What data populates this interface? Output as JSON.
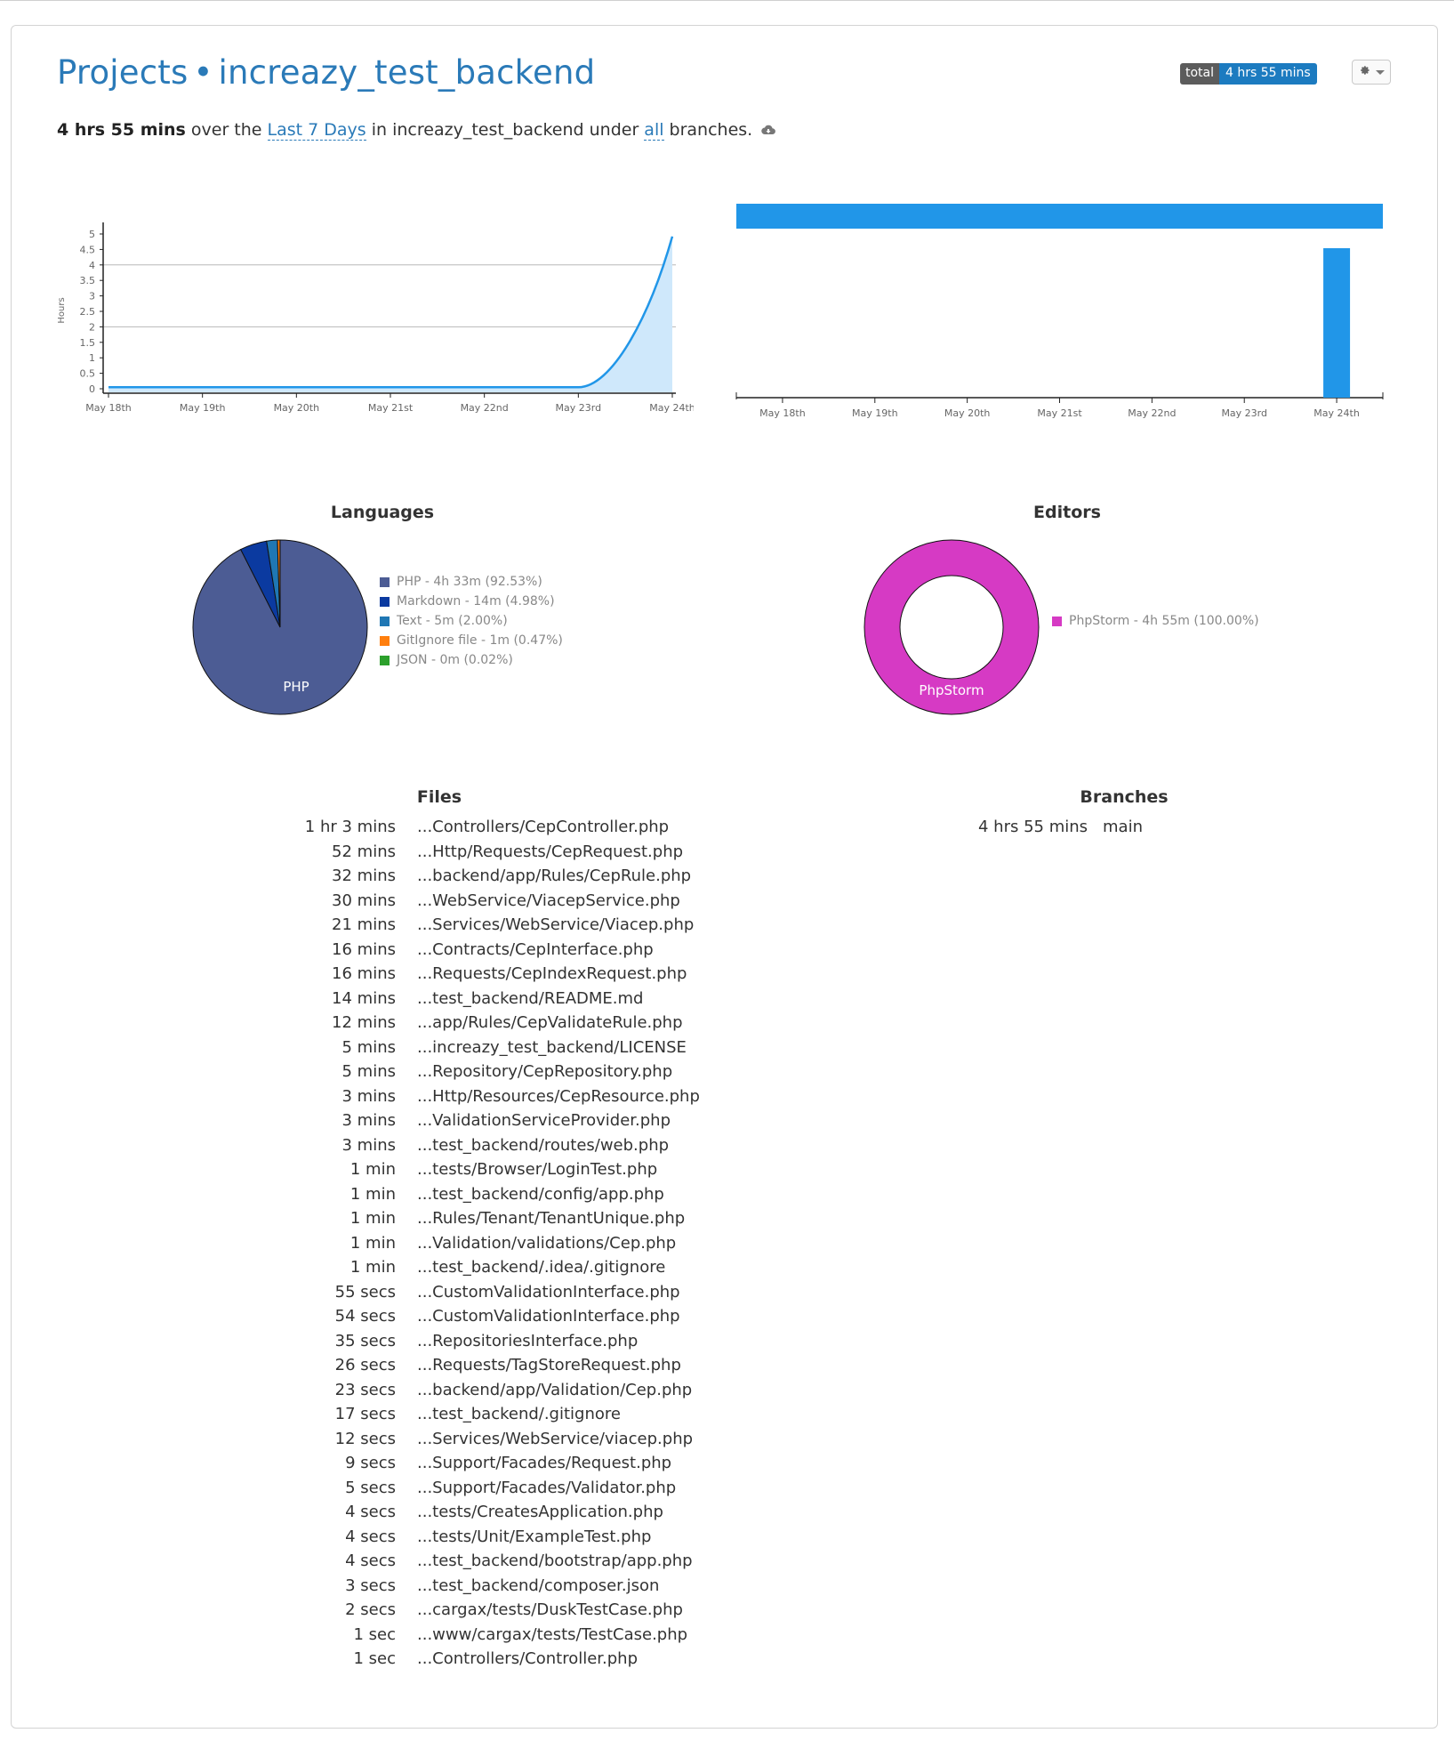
{
  "header": {
    "projects_label": "Projects",
    "separator": "•",
    "project_name": "increazy_test_backend",
    "badge_label": "total",
    "badge_value": "4 hrs 55 mins"
  },
  "summary": {
    "total": "4 hrs 55 mins",
    "text1": " over the ",
    "range_link": "Last 7 Days",
    "text2": " in increazy_test_backend under ",
    "branches_link": "all",
    "text3": " branches."
  },
  "icons": {
    "settings": "gear-icon",
    "cloud": "cloud-download-icon"
  },
  "colors": {
    "accent": "#2a7ab8",
    "line": "#2196e8",
    "area": "#cfe8fb",
    "bar": "#2196e8"
  },
  "chart_data": [
    {
      "type": "area",
      "ylabel": "Hours",
      "x": [
        "May 18th",
        "May 19th",
        "May 20th",
        "May 21st",
        "May 22nd",
        "May 23rd",
        "May 24th"
      ],
      "values": [
        0.05,
        0.05,
        0.05,
        0.05,
        0.05,
        0.05,
        4.92
      ],
      "yticks": [
        "0",
        "0.5",
        "1",
        "1.5",
        "2",
        "2.5",
        "3",
        "3.5",
        "4",
        "4.5",
        "5"
      ],
      "ylim": [
        0,
        5
      ],
      "grid_lines": [
        2,
        4
      ]
    },
    {
      "type": "bar",
      "x": [
        "May 18th",
        "May 19th",
        "May 20th",
        "May 21st",
        "May 22nd",
        "May 23rd",
        "May 24th"
      ],
      "values": [
        0,
        0,
        0,
        0,
        0,
        0,
        4.92
      ],
      "summary_bar": "total"
    },
    {
      "type": "pie",
      "title": "Languages",
      "slices": [
        {
          "label": "PHP - 4h 33m (92.53%)",
          "name": "PHP",
          "value": 92.53,
          "color": "#4c5c94"
        },
        {
          "label": "Markdown - 14m (4.98%)",
          "name": "Markdown",
          "value": 4.98,
          "color": "#0b3aa0"
        },
        {
          "label": "Text - 5m (2.00%)",
          "name": "Text",
          "value": 2.0,
          "color": "#1f77b4"
        },
        {
          "label": "GitIgnore file - 1m (0.47%)",
          "name": "GitIgnore file",
          "value": 0.47,
          "color": "#ff7f0e"
        },
        {
          "label": "JSON - 0m (0.02%)",
          "name": "JSON",
          "value": 0.02,
          "color": "#2ca02c"
        }
      ],
      "inner_label": "PHP"
    },
    {
      "type": "pie",
      "title": "Editors",
      "slices": [
        {
          "label": "PhpStorm - 4h 55m (100.00%)",
          "name": "PhpStorm",
          "value": 100.0,
          "color": "#d63ac4"
        }
      ],
      "inner_label": "PhpStorm"
    }
  ],
  "files": {
    "title": "Files",
    "rows": [
      {
        "time": "1 hr 3 mins",
        "name": "...Controllers/CepController.php"
      },
      {
        "time": "52 mins",
        "name": "...Http/Requests/CepRequest.php"
      },
      {
        "time": "32 mins",
        "name": "...backend/app/Rules/CepRule.php"
      },
      {
        "time": "30 mins",
        "name": "...WebService/ViacepService.php"
      },
      {
        "time": "21 mins",
        "name": "...Services/WebService/Viacep.php"
      },
      {
        "time": "16 mins",
        "name": "...Contracts/CepInterface.php"
      },
      {
        "time": "16 mins",
        "name": "...Requests/CepIndexRequest.php"
      },
      {
        "time": "14 mins",
        "name": "...test_backend/README.md"
      },
      {
        "time": "12 mins",
        "name": "...app/Rules/CepValidateRule.php"
      },
      {
        "time": "5 mins",
        "name": "...increazy_test_backend/LICENSE"
      },
      {
        "time": "5 mins",
        "name": "...Repository/CepRepository.php"
      },
      {
        "time": "3 mins",
        "name": "...Http/Resources/CepResource.php"
      },
      {
        "time": "3 mins",
        "name": "...ValidationServiceProvider.php"
      },
      {
        "time": "3 mins",
        "name": "...test_backend/routes/web.php"
      },
      {
        "time": "1 min",
        "name": "...tests/Browser/LoginTest.php"
      },
      {
        "time": "1 min",
        "name": "...test_backend/config/app.php"
      },
      {
        "time": "1 min",
        "name": "...Rules/Tenant/TenantUnique.php"
      },
      {
        "time": "1 min",
        "name": "...Validation/validations/Cep.php"
      },
      {
        "time": "1 min",
        "name": "...test_backend/.idea/.gitignore"
      },
      {
        "time": "55 secs",
        "name": "...CustomValidationInterface.php"
      },
      {
        "time": "54 secs",
        "name": "...CustomValidationInterface.php"
      },
      {
        "time": "35 secs",
        "name": "...RepositoriesInterface.php"
      },
      {
        "time": "26 secs",
        "name": "...Requests/TagStoreRequest.php"
      },
      {
        "time": "23 secs",
        "name": "...backend/app/Validation/Cep.php"
      },
      {
        "time": "17 secs",
        "name": "...test_backend/.gitignore"
      },
      {
        "time": "12 secs",
        "name": "...Services/WebService/viacep.php"
      },
      {
        "time": "9 secs",
        "name": "...Support/Facades/Request.php"
      },
      {
        "time": "5 secs",
        "name": "...Support/Facades/Validator.php"
      },
      {
        "time": "4 secs",
        "name": "...tests/CreatesApplication.php"
      },
      {
        "time": "4 secs",
        "name": "...tests/Unit/ExampleTest.php"
      },
      {
        "time": "4 secs",
        "name": "...test_backend/bootstrap/app.php"
      },
      {
        "time": "3 secs",
        "name": "...test_backend/composer.json"
      },
      {
        "time": "2 secs",
        "name": "...cargax/tests/DuskTestCase.php"
      },
      {
        "time": "1 sec",
        "name": "...www/cargax/tests/TestCase.php"
      },
      {
        "time": "1 sec",
        "name": "...Controllers/Controller.php"
      }
    ]
  },
  "branches": {
    "title": "Branches",
    "rows": [
      {
        "time": "4 hrs 55 mins",
        "name": "main"
      }
    ]
  }
}
